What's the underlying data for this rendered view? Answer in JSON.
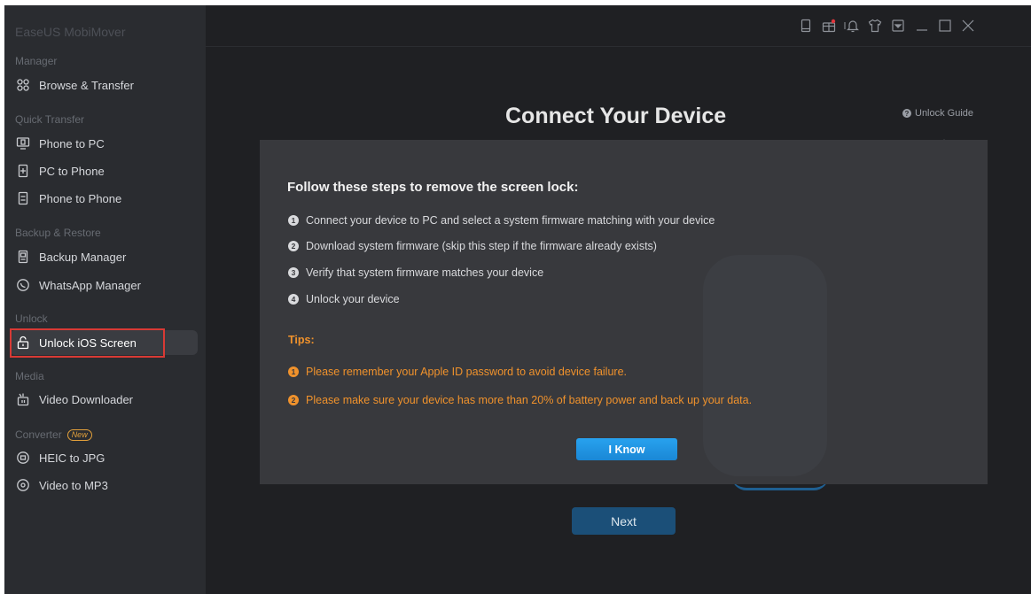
{
  "app": {
    "title": "EaseUS MobiMover"
  },
  "sidebar": {
    "sections": [
      {
        "label": "Manager",
        "items": [
          {
            "label": "Browse & Transfer",
            "icon": "browse-icon"
          }
        ]
      },
      {
        "label": "Quick Transfer",
        "items": [
          {
            "label": "Phone to PC",
            "icon": "phone-to-pc-icon"
          },
          {
            "label": "PC to Phone",
            "icon": "pc-to-phone-icon"
          },
          {
            "label": "Phone to Phone",
            "icon": "phone-to-phone-icon"
          }
        ]
      },
      {
        "label": "Backup & Restore",
        "items": [
          {
            "label": "Backup Manager",
            "icon": "backup-icon"
          },
          {
            "label": "WhatsApp Manager",
            "icon": "whatsapp-icon"
          }
        ]
      },
      {
        "label": "Unlock",
        "items": [
          {
            "label": "Unlock iOS Screen",
            "icon": "unlock-icon",
            "active": true
          }
        ]
      },
      {
        "label": "Media",
        "items": [
          {
            "label": "Video Downloader",
            "icon": "video-downloader-icon"
          }
        ]
      },
      {
        "label": "Converter",
        "badge": "New",
        "items": [
          {
            "label": "HEIC to JPG",
            "icon": "heic-icon"
          },
          {
            "label": "Video to MP3",
            "icon": "video-mp3-icon"
          }
        ]
      }
    ]
  },
  "topbar": {
    "icons": [
      "device-icon",
      "gift-icon",
      "bell-icon",
      "shirt-icon",
      "dropdown-menu-icon",
      "minimize-icon",
      "maximize-icon",
      "close-icon"
    ]
  },
  "main": {
    "title": "Connect Your Device",
    "guide_link": "Unlock Guide",
    "next_button": "Next"
  },
  "dialog": {
    "heading": "Follow these steps to remove the screen lock:",
    "steps": [
      "Connect your device to PC and select a system firmware matching with your device",
      "Download system firmware (skip this step if the firmware already exists)",
      "Verify that system firmware matches your device",
      "Unlock your device"
    ],
    "tips_label": "Tips:",
    "tips": [
      "Please remember your Apple ID password to avoid device failure.",
      "Please make sure your device has more than 20% of battery power and back up your data."
    ],
    "confirm_button": "I Know"
  },
  "colors": {
    "accent": "#1a87d6",
    "tips": "#f0922c",
    "highlight": "#d83a35"
  }
}
